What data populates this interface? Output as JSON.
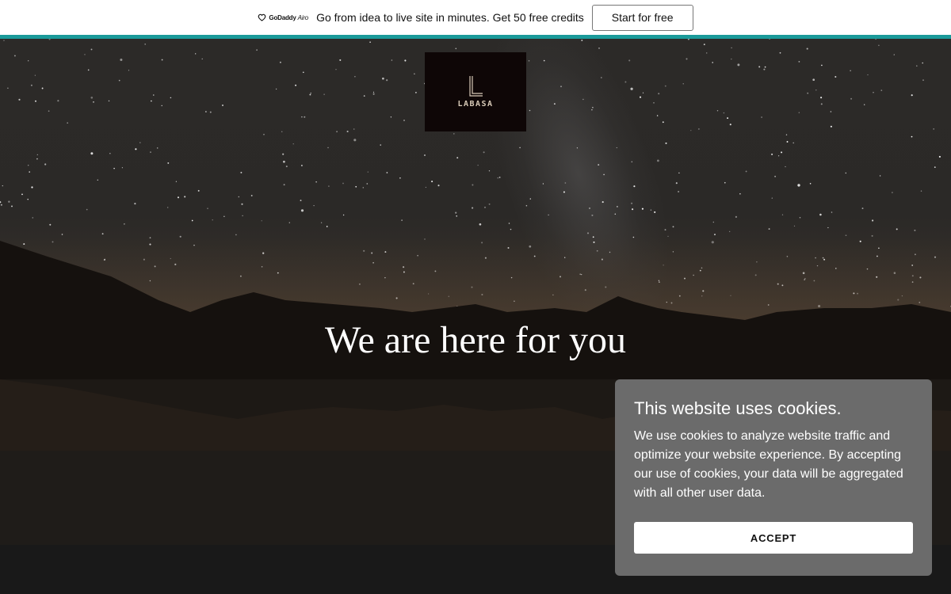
{
  "promo": {
    "logo_brand": "GoDaddy",
    "logo_product": "Airo",
    "text": "Go from idea to live site in minutes. Get 50 free credits",
    "button_label": "Start for free",
    "accent_color": "#1a9a9a"
  },
  "site": {
    "logo_name": "LABASA",
    "hero_title": "We are here for you"
  },
  "cookie": {
    "title": "This website uses cookies.",
    "body": "We use cookies to analyze website traffic and optimize your website experience. By accepting our use of cookies, your data will be aggregated with all other user data.",
    "accept_label": "ACCEPT"
  }
}
